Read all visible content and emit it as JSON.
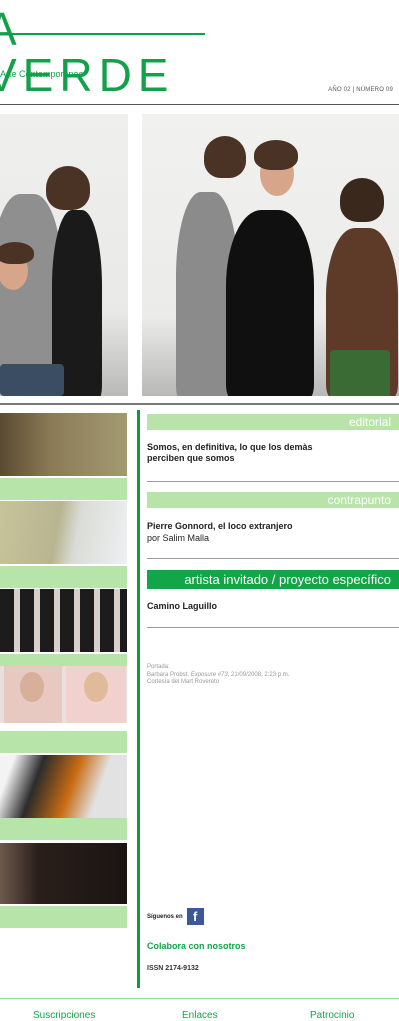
{
  "header": {
    "logo_text": "A VERDE",
    "tagline": "Arte Contemporáneo",
    "issue": "AÑO 02 | NÚMERO 09"
  },
  "sections": {
    "editorial": {
      "label": "editorial",
      "text": "Somos, en definitiva, lo que los demàs perciben que somos"
    },
    "contrapunto": {
      "label": "contrapunto",
      "title": "Pierre Gonnord, el loco extranjero",
      "author": "por Salim Malla"
    },
    "artista": {
      "label": "artista invitado / proyecto específico",
      "title": "Camino Laguillo"
    }
  },
  "caption": {
    "line1": "Portada:",
    "line2_prefix": "Barbara Probst. ",
    "line2_italic": "Exposure #73",
    "line2_suffix": ", 21/09/2008, 2:23 p.m.",
    "line3": "Cortesía del Mart Rovereto"
  },
  "social": {
    "follow_label": "Síguenos en",
    "fb_glyph": "f",
    "colabora": "Colabora con nosotros",
    "issn": "ISSN 2174-9132"
  },
  "footer": {
    "links": [
      "Suscripciones",
      "Enlaces",
      "Patrocinio"
    ]
  },
  "colors": {
    "accent": "#13a548",
    "light_green": "#b9e4a9"
  }
}
